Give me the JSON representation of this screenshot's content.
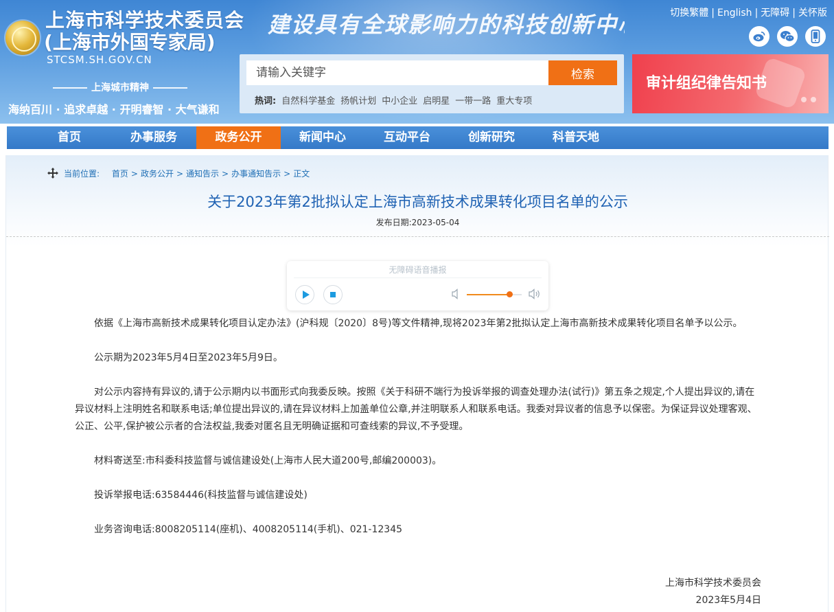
{
  "header": {
    "site_title": "上海市科学技术委员会",
    "site_subtitle": "(上海市外国专家局)",
    "site_domain": "STCSM.SH.GOV.CN",
    "slogan": "建设具有全球影响力的科技创新中心",
    "city_spirit_label": "上海城市精神",
    "city_spirit_text": "海纳百川 · 追求卓越 · 开明睿智 · 大气谦和",
    "top_links": [
      "切换繁體",
      "English",
      "无障碍",
      "关怀版"
    ],
    "social_icons": [
      "weibo-icon",
      "wechat-icon",
      "mobile-icon"
    ]
  },
  "search": {
    "placeholder": "请输入关键字",
    "button_label": "检索",
    "hotwords_label": "热词:",
    "hotwords": [
      "自然科学基金",
      "扬帆计划",
      "中小企业",
      "启明星",
      "一带一路",
      "重大专项"
    ]
  },
  "banner": {
    "text": "审计组纪律告知书"
  },
  "nav": {
    "items": [
      "首页",
      "办事服务",
      "政务公开",
      "新闻中心",
      "互动平台",
      "创新研究",
      "科普天地"
    ],
    "active": "政务公开"
  },
  "breadcrumb": {
    "label": "当前位置:",
    "items": [
      "首页",
      "政务公开",
      "通知告示",
      "办事通知告示",
      "正文"
    ]
  },
  "article": {
    "title": "关于2023年第2批拟认定上海市高新技术成果转化项目名单的公示",
    "publish_date": "发布日期:2023-05-04",
    "paragraphs": [
      "依据《上海市高新技术成果转化项目认定办法》(沪科规〔2020〕8号)等文件精神,现将2023年第2批拟认定上海市高新技术成果转化项目名单予以公示。",
      "公示期为2023年5月4日至2023年5月9日。",
      "对公示内容持有异议的,请于公示期内以书面形式向我委反映。按照《关于科研不端行为投诉举报的调查处理办法(试行)》第五条之规定,个人提出异议的,请在异议材料上注明姓名和联系电话;单位提出异议的,请在异议材料上加盖单位公章,并注明联系人和联系电话。我委对异议者的信息予以保密。为保证异议处理客观、公正、公平,保护被公示者的合法权益,我委对匿名且无明确证据和可查线索的异议,不予受理。",
      "材料寄送至:市科委科技监督与诚信建设处(上海市人民大道200号,邮编200003)。",
      "投诉举报电话:63584446(科技监督与诚信建设处)",
      "业务咨询电话:8008205114(座机)、4008205114(手机)、021-12345"
    ],
    "signature_org": "上海市科学技术委员会",
    "signature_date": "2023年5月4日"
  },
  "audio_player": {
    "label": "无障碍语音播报",
    "volume_fraction": 0.78
  },
  "colors": {
    "header_blue": "#3f86d4",
    "nav_blue": "#3479c8",
    "accent_orange": "#f07015",
    "title_blue": "#1f62b3",
    "banner_red": "#f0404d"
  }
}
